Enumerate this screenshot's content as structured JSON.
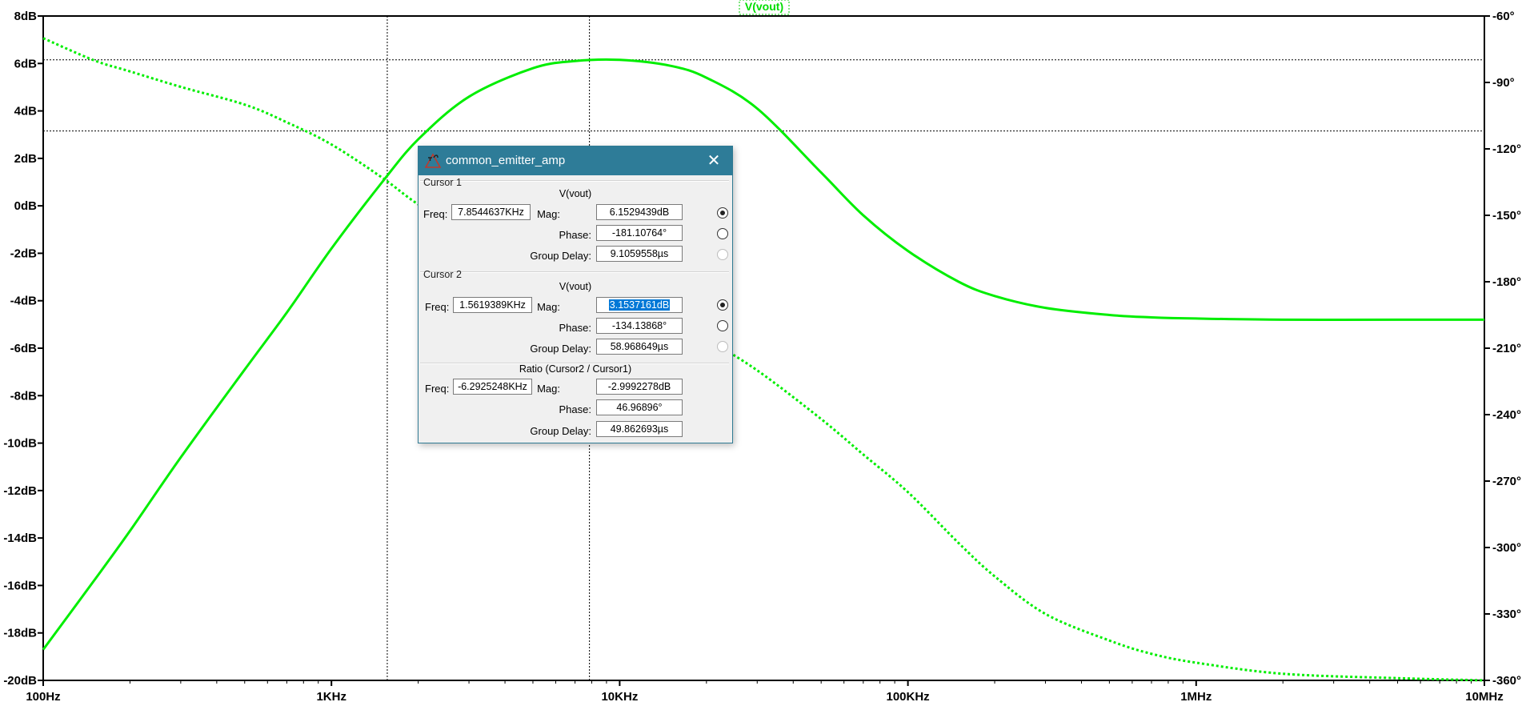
{
  "plot": {
    "trace_name": "V(vout)",
    "trace_color": "#00ee00",
    "x_ticks": [
      "100Hz",
      "1KHz",
      "10KHz",
      "100KHz",
      "1MHz",
      "10MHz"
    ],
    "y_left_ticks": [
      "8dB",
      "6dB",
      "4dB",
      "2dB",
      "0dB",
      "-2dB",
      "-4dB",
      "-6dB",
      "-8dB",
      "-10dB",
      "-12dB",
      "-14dB",
      "-16dB",
      "-18dB",
      "-20dB"
    ],
    "y_right_ticks": [
      "-60°",
      "-90°",
      "-120°",
      "-150°",
      "-180°",
      "-210°",
      "-240°",
      "-270°",
      "-300°",
      "-330°",
      "-360°"
    ]
  },
  "chart_data": {
    "type": "line",
    "x_scale": "log",
    "xlabel": "",
    "ylabel": "",
    "xlim": [
      100,
      10000000
    ],
    "ylim": [
      -20,
      8
    ],
    "y2lim": [
      -360,
      -60
    ],
    "grid": false,
    "series": [
      {
        "name": "V(vout)",
        "style": "solid",
        "axis": "magnitude_dB",
        "x": [
          100,
          150,
          200,
          300,
          500,
          700,
          1000,
          1500,
          2000,
          3000,
          5000,
          7000,
          10000,
          15000,
          20000,
          30000,
          50000,
          70000,
          100000,
          150000,
          200000,
          300000,
          500000,
          700000,
          1000000,
          2000000,
          5000000,
          10000000
        ],
        "y": [
          -18.7,
          -15.8,
          -13.7,
          -10.6,
          -6.9,
          -4.5,
          -1.8,
          1.0,
          2.8,
          4.6,
          5.8,
          6.1,
          6.15,
          5.9,
          5.4,
          4.1,
          1.4,
          -0.4,
          -1.9,
          -3.2,
          -3.8,
          -4.3,
          -4.6,
          -4.7,
          -4.75,
          -4.8,
          -4.8,
          -4.8
        ]
      },
      {
        "name": "V(vout)",
        "style": "dotted",
        "axis": "phase_deg",
        "x": [
          100,
          150,
          200,
          300,
          500,
          700,
          1000,
          1500,
          2000,
          3000,
          5000,
          7000,
          10000,
          15000,
          20000,
          30000,
          50000,
          70000,
          100000,
          150000,
          200000,
          300000,
          500000,
          700000,
          1000000,
          2000000,
          5000000,
          10000000
        ],
        "y": [
          -70,
          -80,
          -85,
          -92,
          -100,
          -108,
          -118,
          -133,
          -145,
          -158,
          -170,
          -178,
          -186,
          -198,
          -206,
          -220,
          -242,
          -258,
          -275,
          -298,
          -313,
          -330,
          -342,
          -348,
          -352,
          -357,
          -359,
          -360
        ]
      }
    ]
  },
  "cursors": {
    "cursor1": {
      "freq": 7854.4637,
      "mag": 6.1529439,
      "phase": -181.10764
    },
    "cursor2": {
      "freq": 1561.9389,
      "mag": 3.1537161,
      "phase": -134.13868
    }
  },
  "dialog": {
    "title": "common_emitter_amp",
    "close_glyph": "✕",
    "cursor1": {
      "header": "Cursor 1",
      "signal": "V(vout)",
      "freq_label": "Freq:",
      "freq": "7.8544637KHz",
      "mag_label": "Mag:",
      "mag": "6.1529439dB",
      "phase_label": "Phase:",
      "phase": "-181.10764°",
      "gd_label": "Group Delay:",
      "gd": "9.1059558µs"
    },
    "cursor2": {
      "header": "Cursor 2",
      "signal": "V(vout)",
      "freq_label": "Freq:",
      "freq": "1.5619389KHz",
      "mag_label": "Mag:",
      "mag": "3.1537161dB",
      "phase_label": "Phase:",
      "phase": "-134.13868°",
      "gd_label": "Group Delay:",
      "gd": "58.968649µs"
    },
    "ratio": {
      "header": "Ratio (Cursor2 / Cursor1)",
      "freq_label": "Freq:",
      "freq": "-6.2925248KHz",
      "mag_label": "Mag:",
      "mag": "-2.9992278dB",
      "phase_label": "Phase:",
      "phase": "46.96896°",
      "gd_label": "Group Delay:",
      "gd": "49.862693µs"
    }
  }
}
